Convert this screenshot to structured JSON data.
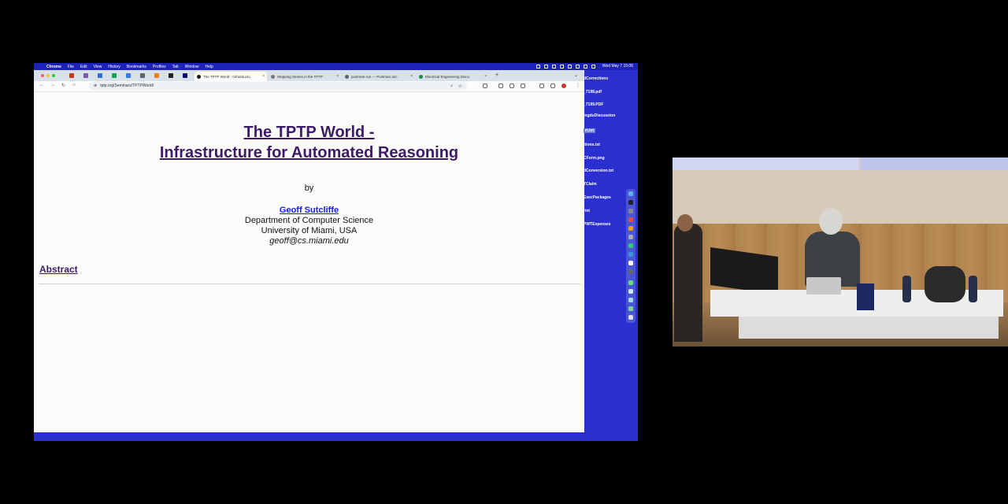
{
  "menubar": {
    "items": [
      "Chrome",
      "File",
      "Edit",
      "View",
      "History",
      "Bookmarks",
      "Profiles",
      "Tab",
      "Window",
      "Help"
    ],
    "clock": "Wed May 7  15:06"
  },
  "tabs": [
    {
      "label": "The TPTP World - Infrastructu",
      "active": true,
      "favicon_color": "#1a1a1a"
    },
    {
      "label": "Stepping Stones in the TPTP",
      "active": false,
      "favicon_color": "#777777"
    },
    {
      "label": "postman-run — Postman doc",
      "active": false,
      "favicon_color": "#5a6470"
    },
    {
      "label": "Electrical Engineering Discu",
      "active": false,
      "favicon_color": "#1b8f3a"
    }
  ],
  "address": {
    "url": "tptp.org/Seminars/TPTPWorld/"
  },
  "page": {
    "title_line1": "The TPTP World -",
    "title_line2": "Infrastructure for Automated Reasoning",
    "by": "by",
    "author": "Geoff Sutcliffe",
    "department": "Department of Computer Science",
    "university": "University of Miami, USA",
    "email": "geoff@cs.miami.edu",
    "abstract_link": "Abstract"
  },
  "desktop_files": [
    {
      "name": "dCorrections",
      "selected": false
    },
    {
      "name": "_7198.pdf",
      "selected": false
    },
    {
      "name": "_7199.PDF",
      "selected": false
    },
    {
      "name": "ingduDiscussion",
      "selected": false
    },
    {
      "name": "rt.txt",
      "selected": true
    },
    {
      "name": "itions.txt",
      "selected": false
    },
    {
      "name": "CForm.png",
      "selected": false
    },
    {
      "name": "dConversion.txt",
      "selected": false
    },
    {
      "name": "TClaim",
      "selected": false
    },
    {
      "name": "ExecPackages",
      "selected": false
    },
    {
      "name": "rint",
      "selected": false
    },
    {
      "name": "PWTExpenses",
      "selected": false
    }
  ],
  "colors": {
    "desktop": "#2b2fd0",
    "title": "#3d1a6a",
    "author_link": "#1620d8",
    "fab": "#2db84c"
  },
  "icons": {
    "fab": "pencil-icon",
    "back": "back-arrow-icon",
    "forward": "forward-arrow-icon",
    "reload": "reload-icon",
    "home": "home-icon"
  }
}
